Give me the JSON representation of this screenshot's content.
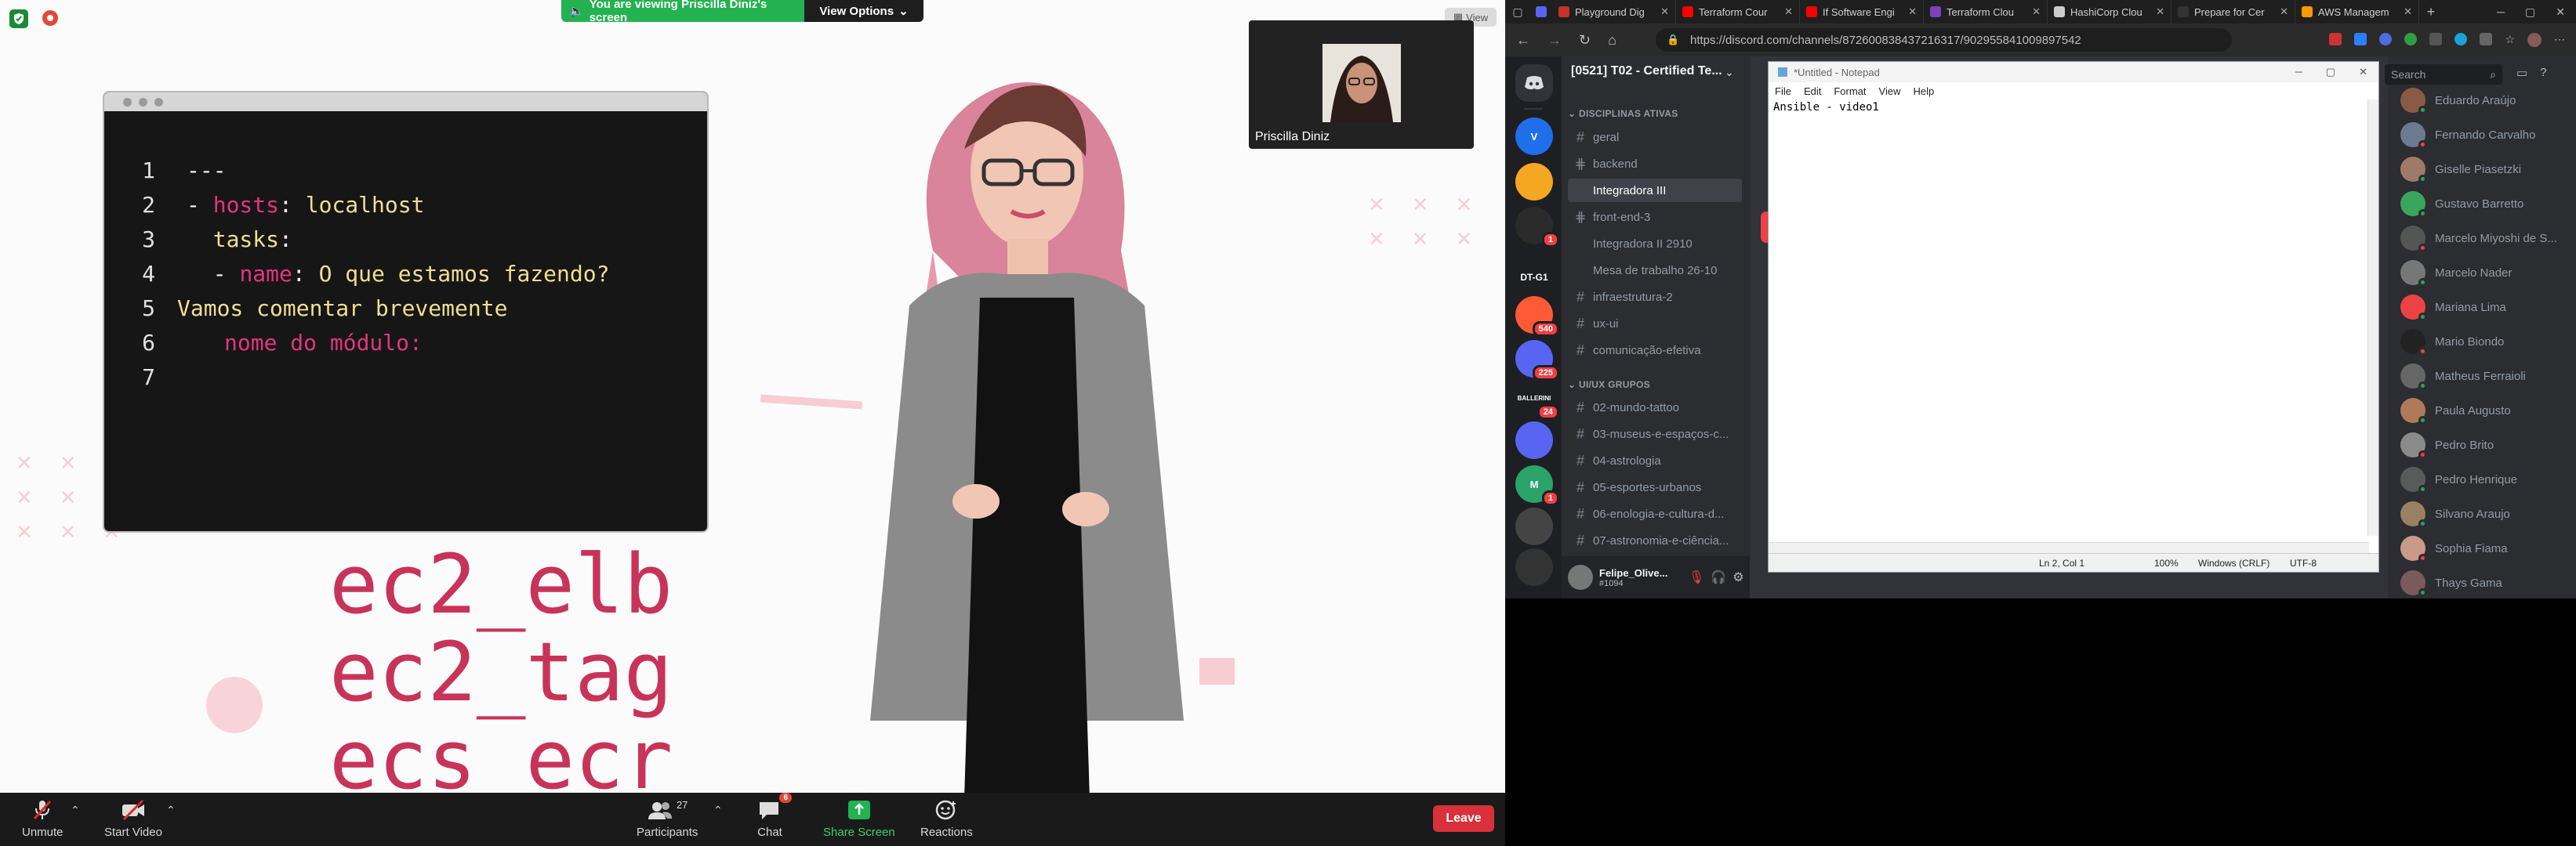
{
  "zoom": {
    "share_banner": "You are viewing Priscilla Diniz's screen",
    "view_options": "View Options",
    "view_button": "View",
    "thumbnail_name": "Priscilla Diniz",
    "code": {
      "line_numbers": [
        "1",
        "2",
        "3",
        "4",
        "5",
        "6",
        "7"
      ],
      "l1": "---",
      "l2_dash": "- ",
      "l2_key": "hosts",
      "l2_colon": ": ",
      "l2_val": "localhost",
      "l3_key": "tasks",
      "l3_colon": ":",
      "l4_dash": "- ",
      "l4_key": "name",
      "l4_colon": ": ",
      "l4_val": "O que estamos fazendo?",
      "l5": "Vamos comentar brevemente",
      "l6": "nome do módulo:"
    },
    "big_words": [
      "ec2_elb",
      "ec2_tag",
      "ecs_ecr"
    ],
    "toolbar": {
      "unmute": "Unmute",
      "start_video": "Start Video",
      "participants": "Participants",
      "participants_count": "27",
      "chat": "Chat",
      "chat_badge": "6",
      "share_screen": "Share Screen",
      "reactions": "Reactions",
      "leave": "Leave"
    }
  },
  "browser": {
    "tabs": [
      {
        "label": "Playground Dig",
        "color": "#c9302c"
      },
      {
        "label": "Terraform Cour",
        "color": "#ff0000"
      },
      {
        "label": "If Software Engi",
        "color": "#ff0000"
      },
      {
        "label": "Terraform Clou",
        "color": "#7b42bc"
      },
      {
        "label": "HashiCorp Clou",
        "color": "#cccccc"
      },
      {
        "label": "Prepare for Cer",
        "color": "#333333"
      },
      {
        "label": "AWS Managem",
        "color": "#ff9900"
      }
    ],
    "url": "https://discord.com/channels/872600838437216317/902955841009897542"
  },
  "discord": {
    "guild_name": "[0521] T02 - Certified Te...",
    "servers": [
      {
        "label": "V",
        "color": "#1f6feb"
      },
      {
        "label": "",
        "color": "#f5a623"
      },
      {
        "label": "",
        "color": "#2b2b2b",
        "badge": "1"
      },
      {
        "label": "DT-G1",
        "color": "#1e1f22"
      },
      {
        "label": "",
        "color": "#ff5a36",
        "badge": "540"
      },
      {
        "label": "",
        "color": "#5865f2",
        "badge": "225"
      },
      {
        "label": "BALLERINI",
        "color": "#1e1f22",
        "badge": "24"
      },
      {
        "label": "",
        "color": "#5865f2"
      },
      {
        "label": "M",
        "color": "#29a36a",
        "badge": "1"
      },
      {
        "label": "",
        "color": "#444"
      },
      {
        "label": "",
        "color": "#333"
      }
    ],
    "categories": {
      "ativas": "DISCIPLINAS ATIVAS",
      "grupos": "UI/UX GRUPOS"
    },
    "channels_ativas": [
      {
        "name": "geral",
        "icon": "#"
      },
      {
        "name": "backend",
        "icon": "thread"
      },
      {
        "name": "Integradora III",
        "icon": "",
        "active": true
      },
      {
        "name": "front-end-3",
        "icon": "thread"
      },
      {
        "name": "Integradora II 2910",
        "icon": ""
      },
      {
        "name": "Mesa de trabalho 26-10",
        "icon": ""
      },
      {
        "name": "infraestrutura-2",
        "icon": "#"
      },
      {
        "name": "ux-ui",
        "icon": "#"
      },
      {
        "name": "comunicação-efetiva",
        "icon": "#"
      }
    ],
    "channels_grupos": [
      {
        "name": "02-mundo-tattoo"
      },
      {
        "name": "03-museus-e-espaços-c..."
      },
      {
        "name": "04-astrologia"
      },
      {
        "name": "05-esportes-urbanos"
      },
      {
        "name": "06-enologia-e-cultura-d..."
      },
      {
        "name": "07-astronomia-e-ciência..."
      }
    ],
    "user": {
      "name": "Felipe_Olive...",
      "tag": "#1094"
    },
    "search_placeholder": "Search",
    "members": [
      {
        "name": "Eduardo Araújo",
        "color": "#8a5a44"
      },
      {
        "name": "Fernando Carvalho",
        "color": "#6b7a8f"
      },
      {
        "name": "Giselle Piasetzki",
        "color": "#a07a68"
      },
      {
        "name": "Gustavo Barretto",
        "color": "#3ba55c"
      },
      {
        "name": "Marcelo Miyoshi de S...",
        "color": "#555"
      },
      {
        "name": "Marcelo Nader",
        "color": "#777"
      },
      {
        "name": "Mariana Lima",
        "color": "#ed4245"
      },
      {
        "name": "Mario Biondo",
        "color": "#222"
      },
      {
        "name": "Matheus Ferraioli",
        "color": "#666"
      },
      {
        "name": "Paula Augusto",
        "color": "#b07a5a"
      },
      {
        "name": "Pedro Brito",
        "color": "#8a8a8a"
      },
      {
        "name": "Pedro Henrique",
        "color": "#5a5a5a"
      },
      {
        "name": "Silvano Araujo",
        "color": "#9a8060"
      },
      {
        "name": "Sophia Fiama",
        "color": "#c99a8a"
      },
      {
        "name": "Thays Gama",
        "color": "#7a5a5a"
      }
    ]
  },
  "notepad": {
    "title": "*Untitled - Notepad",
    "menu": [
      "File",
      "Edit",
      "Format",
      "View",
      "Help"
    ],
    "content": "Ansible - video1",
    "status": {
      "position": "Ln 2, Col 1",
      "zoom": "100%",
      "eol": "Windows (CRLF)",
      "encoding": "UTF-8"
    }
  },
  "colors": {
    "zoom_green": "#23b24f",
    "leave_red": "#d9303b",
    "discord_bg": "#313338"
  }
}
